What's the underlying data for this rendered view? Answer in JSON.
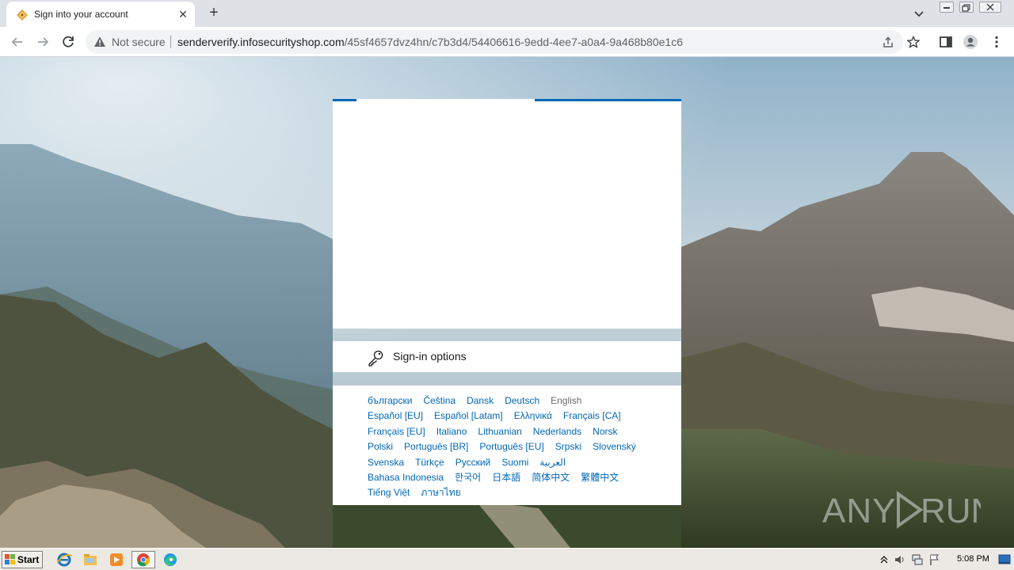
{
  "browser": {
    "tab_title": "Sign into your account",
    "new_tab_symbol": "+",
    "close_symbol": "✕",
    "security_text": "Not secure",
    "url_host": "senderverify.infosecurityshop.com",
    "url_path": "/45sf4657dvz4hn/c7b3d4/54406616-9edd-4ee7-a0a4-9a468b80e1c6"
  },
  "login": {
    "progress_color": "#0067b8",
    "signin_options_label": "Sign-in options",
    "current_language": "English",
    "languages": [
      [
        "български",
        "Čeština",
        "Dansk",
        "Deutsch",
        "English"
      ],
      [
        "Español [EU]",
        "Español [Latam]",
        "Ελληνικά",
        "Français [CA]"
      ],
      [
        "Français [EU]",
        "Italiano",
        "Lithuanian",
        "Nederlands",
        "Norsk"
      ],
      [
        "Polski",
        "Português [BR]",
        "Português [EU]",
        "Srpski",
        "Slovenský"
      ],
      [
        "Svenska",
        "Türkçe",
        "Русский",
        "Suomi",
        "العربية"
      ],
      [
        "Bahasa Indonesia",
        "한국어",
        "日本語",
        "简体中文",
        "繁體中文"
      ],
      [
        "Tiếng Việt",
        "ภาษาไทย"
      ]
    ]
  },
  "watermark": "ANY RUN",
  "taskbar": {
    "start_label": "Start",
    "time": "5:08 PM",
    "apps": [
      "internet-explorer-icon",
      "file-explorer-icon",
      "media-player-icon",
      "chrome-icon",
      "edge-icon"
    ]
  }
}
